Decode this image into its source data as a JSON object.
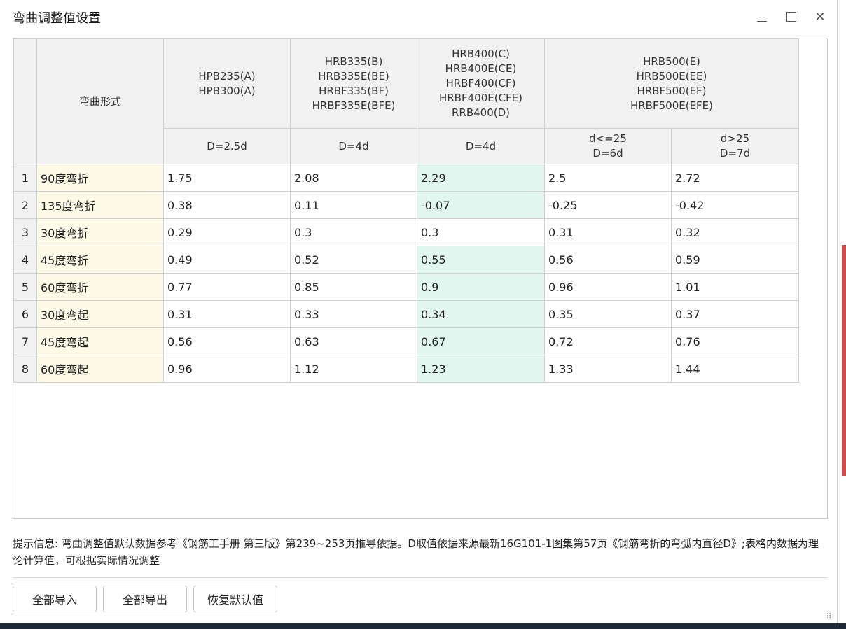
{
  "window": {
    "title": "弯曲调整值设置"
  },
  "table": {
    "form_header": "弯曲形式",
    "groups": [
      {
        "lines": [
          "HPB235(A)",
          "HPB300(A)"
        ]
      },
      {
        "lines": [
          "HRB335(B)",
          "HRB335E(BE)",
          "HRBF335(BF)",
          "HRBF335E(BFE)"
        ]
      },
      {
        "lines": [
          "HRB400(C)",
          "HRB400E(CE)",
          "HRBF400(CF)",
          "HRBF400E(CFE)",
          "RRB400(D)"
        ]
      },
      {
        "lines": [
          "HRB500(E)",
          "HRB500E(EE)",
          "HRBF500(EF)",
          "HRBF500E(EFE)"
        ]
      }
    ],
    "sub_headers": [
      {
        "lines": [
          "D=2.5d"
        ]
      },
      {
        "lines": [
          "D=4d"
        ]
      },
      {
        "lines": [
          "D=4d"
        ]
      },
      {
        "lines": [
          "d<=25",
          "D=6d"
        ]
      },
      {
        "lines": [
          "d>25",
          "D=7d"
        ]
      }
    ],
    "rows": [
      {
        "num": "1",
        "form": "90度弯折",
        "values": [
          "1.75",
          "2.08",
          "2.29",
          "2.5",
          "2.72"
        ],
        "highlight": true
      },
      {
        "num": "2",
        "form": "135度弯折",
        "values": [
          "0.38",
          "0.11",
          "-0.07",
          "-0.25",
          "-0.42"
        ],
        "highlight": true
      },
      {
        "num": "3",
        "form": "30度弯折",
        "values": [
          "0.29",
          "0.3",
          "0.3",
          "0.31",
          "0.32"
        ],
        "highlight": false
      },
      {
        "num": "4",
        "form": "45度弯折",
        "values": [
          "0.49",
          "0.52",
          "0.55",
          "0.56",
          "0.59"
        ],
        "highlight": true
      },
      {
        "num": "5",
        "form": "60度弯折",
        "values": [
          "0.77",
          "0.85",
          "0.9",
          "0.96",
          "1.01"
        ],
        "highlight": true
      },
      {
        "num": "6",
        "form": "30度弯起",
        "values": [
          "0.31",
          "0.33",
          "0.34",
          "0.35",
          "0.37"
        ],
        "highlight": true
      },
      {
        "num": "7",
        "form": "45度弯起",
        "values": [
          "0.56",
          "0.63",
          "0.67",
          "0.72",
          "0.76"
        ],
        "highlight": true
      },
      {
        "num": "8",
        "form": "60度弯起",
        "values": [
          "0.96",
          "1.12",
          "1.23",
          "1.33",
          "1.44"
        ],
        "highlight": true
      }
    ]
  },
  "info": {
    "text": "提示信息: 弯曲调整值默认数据参考《钢筋工手册 第三版》第239~253页推导依据。D取值依据来源最新16G101-1图集第57页《钢筋弯折的弯弧内直径D》;表格内数据为理论计算值，可根据实际情况调整"
  },
  "buttons": {
    "import_all": "全部导入",
    "export_all": "全部导出",
    "restore_default": "恢复默认值"
  },
  "colors": {
    "form_cell": "#fdfbe8",
    "highlight_cell": "#e1f6ee",
    "header_bg": "#f1f1f1"
  }
}
